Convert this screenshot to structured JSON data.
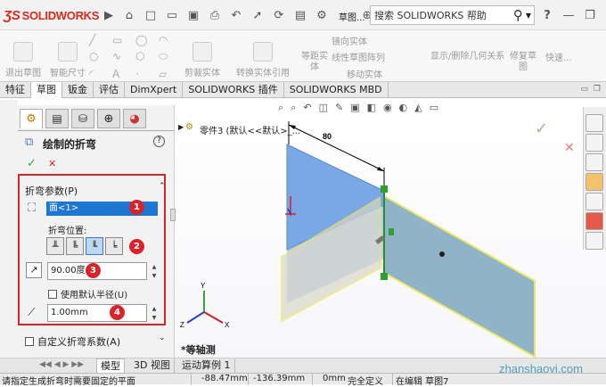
{
  "titlebar": {
    "logo_text": "SOLIDWORKS",
    "doc_label": "草图...",
    "search_placeholder": "搜索 SOLIDWORKS 帮助",
    "help_label": "?",
    "minimize": "—",
    "restore": "❐"
  },
  "commands": {
    "exit_sketch": "退出草图",
    "smart_dim": "智能尺寸",
    "trim_entities": "剪裁实体",
    "convert_entities": "转换实体引用",
    "offset_line1": "等距实",
    "offset_line2": "体",
    "mirror_entities": "镜向实体",
    "linear_pattern": "线性草图阵列",
    "move_entities": "移动实体",
    "display_relations": "显示/删除几何关系",
    "repair_line1": "修复草",
    "repair_line2": "图",
    "quick_snaps": "快速..."
  },
  "tabs": [
    "特征",
    "草图",
    "钣金",
    "评估",
    "DimXpert",
    "SOLIDWORKS 插件",
    "SOLIDWORKS MBD"
  ],
  "active_tab": "草图",
  "panel": {
    "title": "绘制的折弯",
    "help": "?",
    "ok": "✓",
    "cancel": "✕",
    "group_title": "折弯参数(P)",
    "face_value": "面<1>",
    "position_label": "折弯位置:",
    "angle_value": "90.00度",
    "use_default_radius": "使用默认半径(U)",
    "radius_value": "1.00mm",
    "custom_bend": "自定义折弯系数(A)",
    "callouts": [
      "1",
      "2",
      "3",
      "4"
    ]
  },
  "viewport": {
    "tree_label": "零件3 (默认<<默认>_...",
    "dimension": "80",
    "view_name": "*等轴测",
    "triad_y": "Y",
    "triad_x": "X",
    "triad_z": "Z"
  },
  "bottom_tabs": [
    "模型",
    "3D 视图",
    "运动算例 1"
  ],
  "status": {
    "message": "请指定生成折弯时需要固定的平面",
    "x": "-88.47mm",
    "y": "-136.39mm",
    "z": "0mm",
    "state": "完全定义",
    "editing": "在编辑 草图7"
  },
  "watermark": "zhanshaoyi.com",
  "colors": {
    "brand": "#d52b1e",
    "callout": "#d8232a",
    "selection": "#1e76d3",
    "sheet_blue": "#7aa7e6",
    "sheet_flat": "#8fb3c7",
    "ok_green": "#3aa335"
  }
}
